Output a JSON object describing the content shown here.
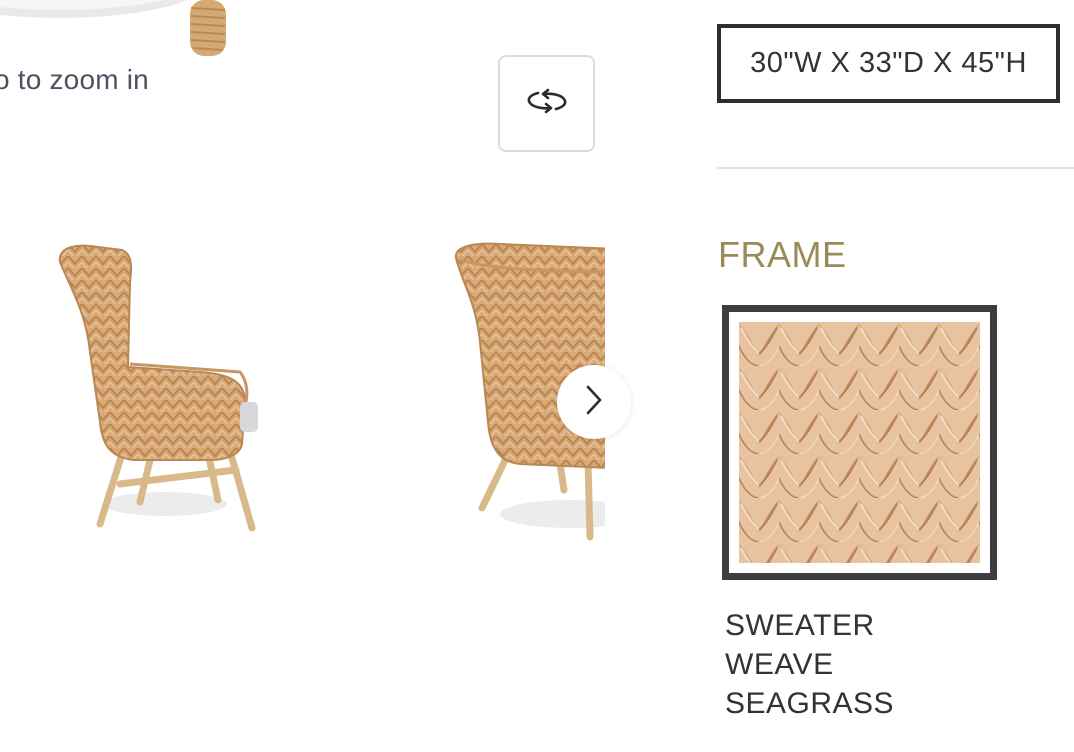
{
  "viewer": {
    "zoom_hint": "o to zoom in",
    "rotate_icon": "rotate-360-icon",
    "next_icon": "chevron-right-icon"
  },
  "product": {
    "dimensions": "30\"W X 33\"D X 45\"H"
  },
  "options": {
    "frame_heading": "FRAME",
    "selected_swatch": {
      "name_lines": [
        "SWEATER",
        "WEAVE",
        "SEAGRASS"
      ]
    }
  },
  "colors": {
    "heading_gold": "#9a8a57",
    "text_dark": "#333333",
    "border_dark": "#2e2e2e",
    "wicker": "#d9a877"
  }
}
